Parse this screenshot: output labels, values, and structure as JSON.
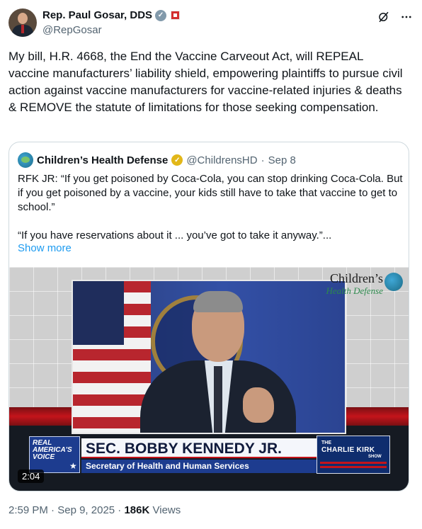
{
  "author": {
    "display_name": "Rep. Paul Gosar, DDS",
    "handle": "@RepGosar",
    "verified_icon": "gray-check-badge-icon",
    "affiliate_icon": "congress-affiliate-icon"
  },
  "header_actions": {
    "grok_icon": "grok-icon",
    "more_icon": "more-dots-icon"
  },
  "tweet": {
    "text": "My bill, H.R. 4668, the End the Vaccine Carveout Act, will REPEAL vaccine manufacturers’ liability shield, empowering plaintiffs to pursue civil action against vaccine manufacturers for vaccine-related injuries & deaths & REMOVE the statute of limitations for those seeking compensation."
  },
  "quote": {
    "display_name": "Children’s Health Defense",
    "handle": "@ChildrensHD",
    "separator": "·",
    "date": "Sep 8",
    "paragraph1": "RFK JR: “If you get poisoned by Coca-Cola, you can stop drinking Coca-Cola. But if you get poisoned by a vaccine, your kids still have to take that vaccine to get to school.”",
    "paragraph2": "“If you have reservations about it ... you’ve got to take it anyway.”...",
    "show_more": "Show more",
    "video": {
      "logo_line1": "Children’s",
      "logo_line2": "Health Defense",
      "network_name": "REAL AMERICA'S VOICE",
      "chyron_title": "SEC. BOBBY KENNEDY JR.",
      "chyron_subtitle": "Secretary of Health and Human Services",
      "show_small": "THE",
      "show_main": "CHARLIE KIRK",
      "show_sub": "SHOW",
      "duration": "2:04"
    }
  },
  "meta": {
    "time": "2:59 PM",
    "date": "Sep 9, 2025",
    "separator": "·",
    "views_count": "186K",
    "views_label": "Views"
  },
  "colors": {
    "text": "#0f1419",
    "secondary": "#536471",
    "link": "#1d9bf0",
    "border": "#cfd9de"
  }
}
